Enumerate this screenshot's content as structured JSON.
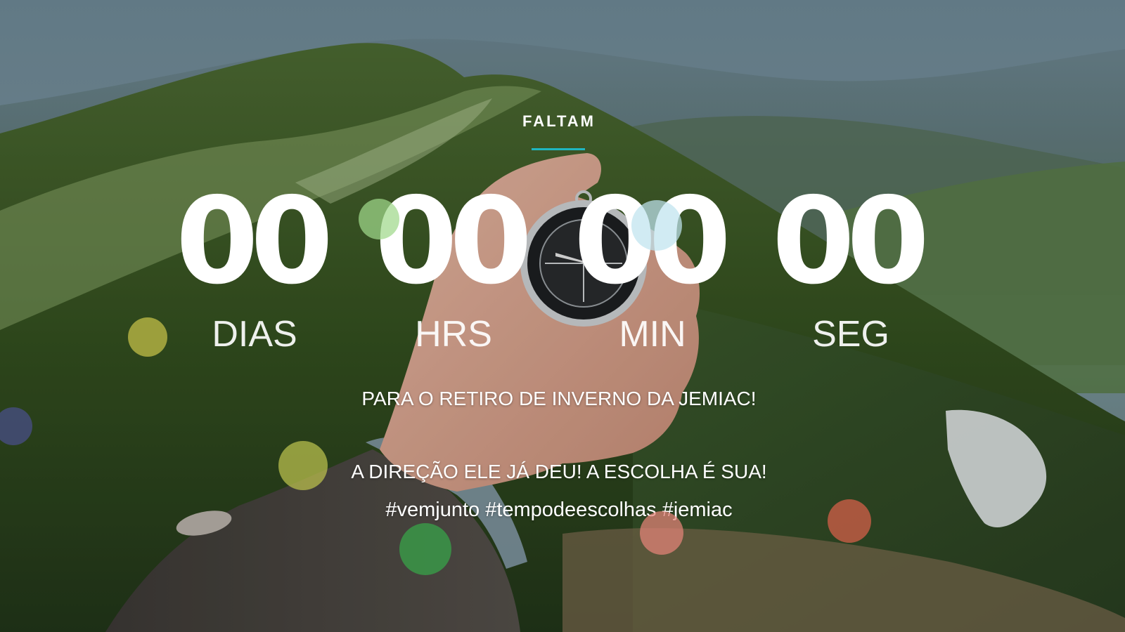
{
  "countdown": {
    "heading": "FALTAM",
    "accent_color": "#1fb6c1",
    "units": [
      {
        "value": "00",
        "label": "DIAS"
      },
      {
        "value": "00",
        "label": "HRS"
      },
      {
        "value": "00",
        "label": "MIN"
      },
      {
        "value": "00",
        "label": "SEG"
      }
    ]
  },
  "message": {
    "event": "PARA O RETIRO DE INVERNO DA JEMIAC!",
    "choice": "A DIREÇÃO ELE JÁ DEU! A ESCOLHA É SUA!",
    "hashtags": "#vemjunto #tempodeescolhas #jemiac"
  },
  "decorative_dots": {
    "colors": [
      "#9fd88a",
      "#bfe3ef",
      "#c8c24a",
      "#4a4f8a",
      "#bcc24e",
      "#38a64a",
      "#e58378",
      "#d9604a"
    ]
  }
}
